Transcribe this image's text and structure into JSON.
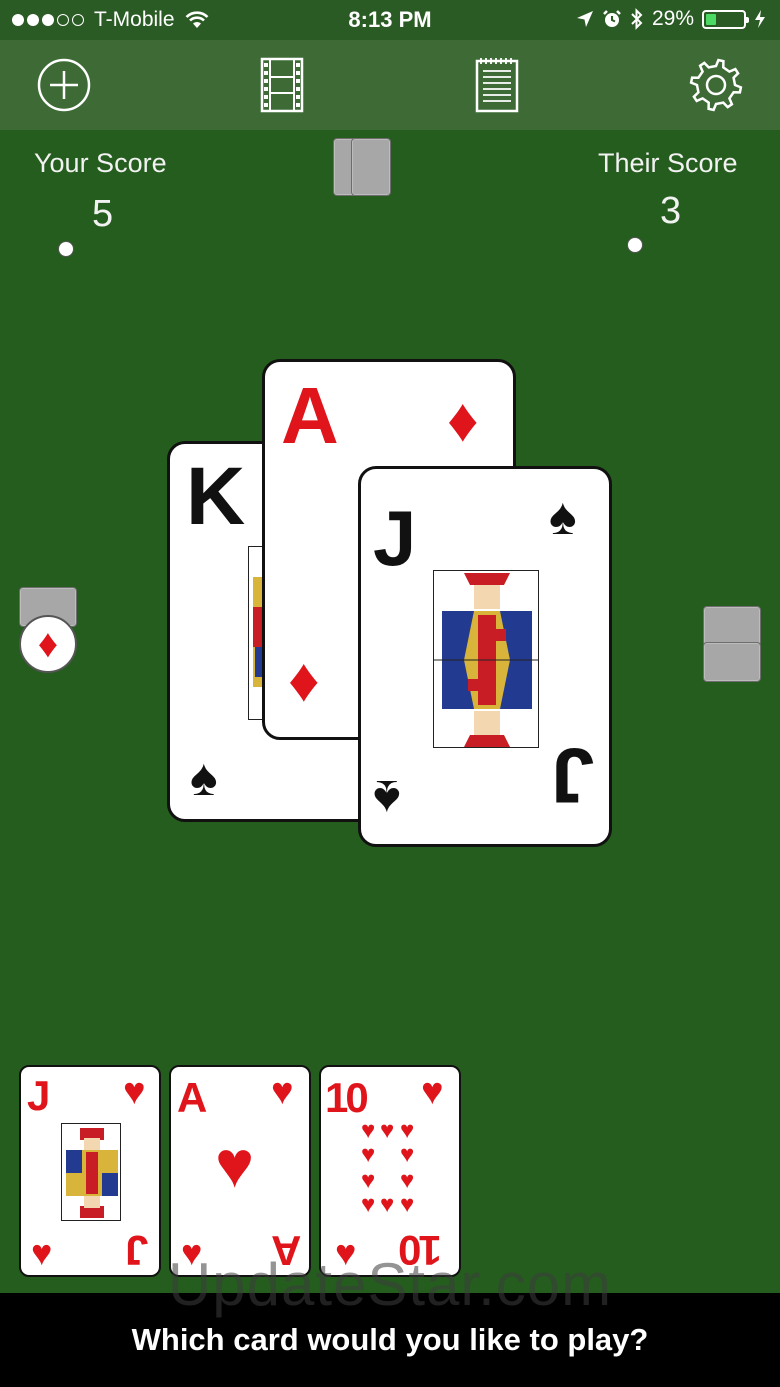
{
  "status": {
    "carrier": "T-Mobile",
    "time": "8:13 PM",
    "battery_percent_label": "29%",
    "battery_level": 0.29,
    "signal_bars_filled": 3,
    "signal_bars_total": 5
  },
  "toolbar": {
    "items": [
      {
        "icon": "plus-circle-icon"
      },
      {
        "icon": "film-icon"
      },
      {
        "icon": "notepad-icon"
      },
      {
        "icon": "gear-icon"
      }
    ]
  },
  "scores": {
    "yours_label": "Your Score",
    "yours_value": "5",
    "theirs_label": "Their Score",
    "theirs_value": "3"
  },
  "trump": {
    "suit_glyph": "♦",
    "suit": "diamonds"
  },
  "table": {
    "cards": [
      {
        "rank": "K",
        "suit_glyph": "♠",
        "color": "black",
        "face": true
      },
      {
        "rank": "A",
        "suit_glyph": "♦",
        "color": "red",
        "face": false
      },
      {
        "rank": "J",
        "suit_glyph": "♠",
        "color": "black",
        "face": true
      }
    ]
  },
  "hand": {
    "cards": [
      {
        "rank": "J",
        "suit_glyph": "♥",
        "color": "red"
      },
      {
        "rank": "A",
        "suit_glyph": "♥",
        "color": "red"
      },
      {
        "rank": "10",
        "suit_glyph": "♥",
        "color": "red"
      }
    ]
  },
  "prompt": "Which card would you like to play?",
  "watermark": "UpdateStar.com",
  "colors": {
    "felt": "#255d1e",
    "toolbar": "#3d6a35",
    "red_suit": "#e0151b",
    "battery": "#4cd964"
  }
}
